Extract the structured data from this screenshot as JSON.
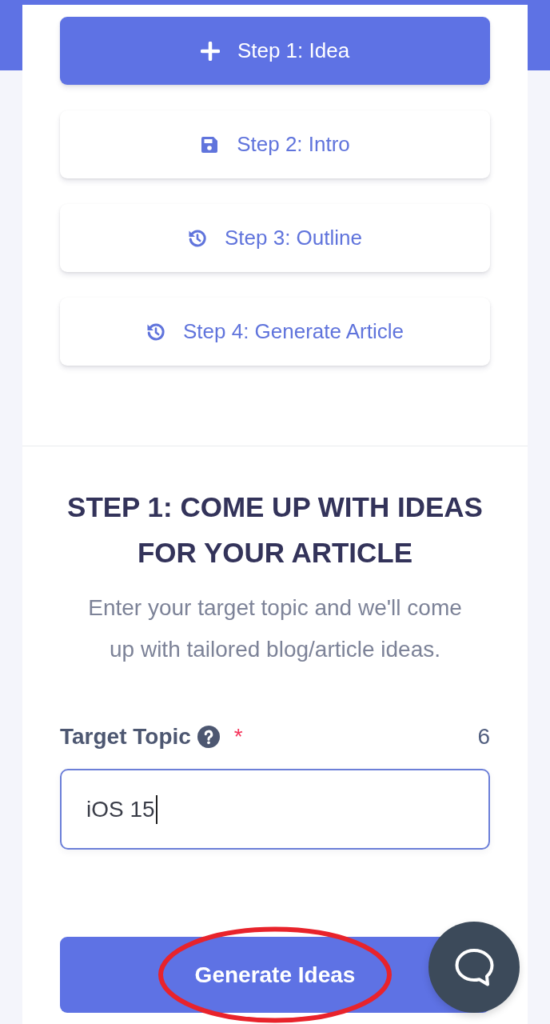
{
  "steps": [
    {
      "label": "Step 1: Idea",
      "selected": true
    },
    {
      "label": "Step 2: Intro",
      "selected": false
    },
    {
      "label": "Step 3: Outline",
      "selected": false
    },
    {
      "label": "Step 4: Generate Article",
      "selected": false
    }
  ],
  "section": {
    "heading": "STEP 1: COME UP WITH IDEAS FOR YOUR ARTICLE",
    "description": "Enter your target topic and we'll come up with tailored blog/article ideas."
  },
  "field": {
    "label": "Target Topic",
    "required_mark": "*",
    "char_count": "6",
    "value": "iOS 15",
    "focused": true
  },
  "generate_button": {
    "label": "Generate Ideas",
    "circled": true
  }
}
